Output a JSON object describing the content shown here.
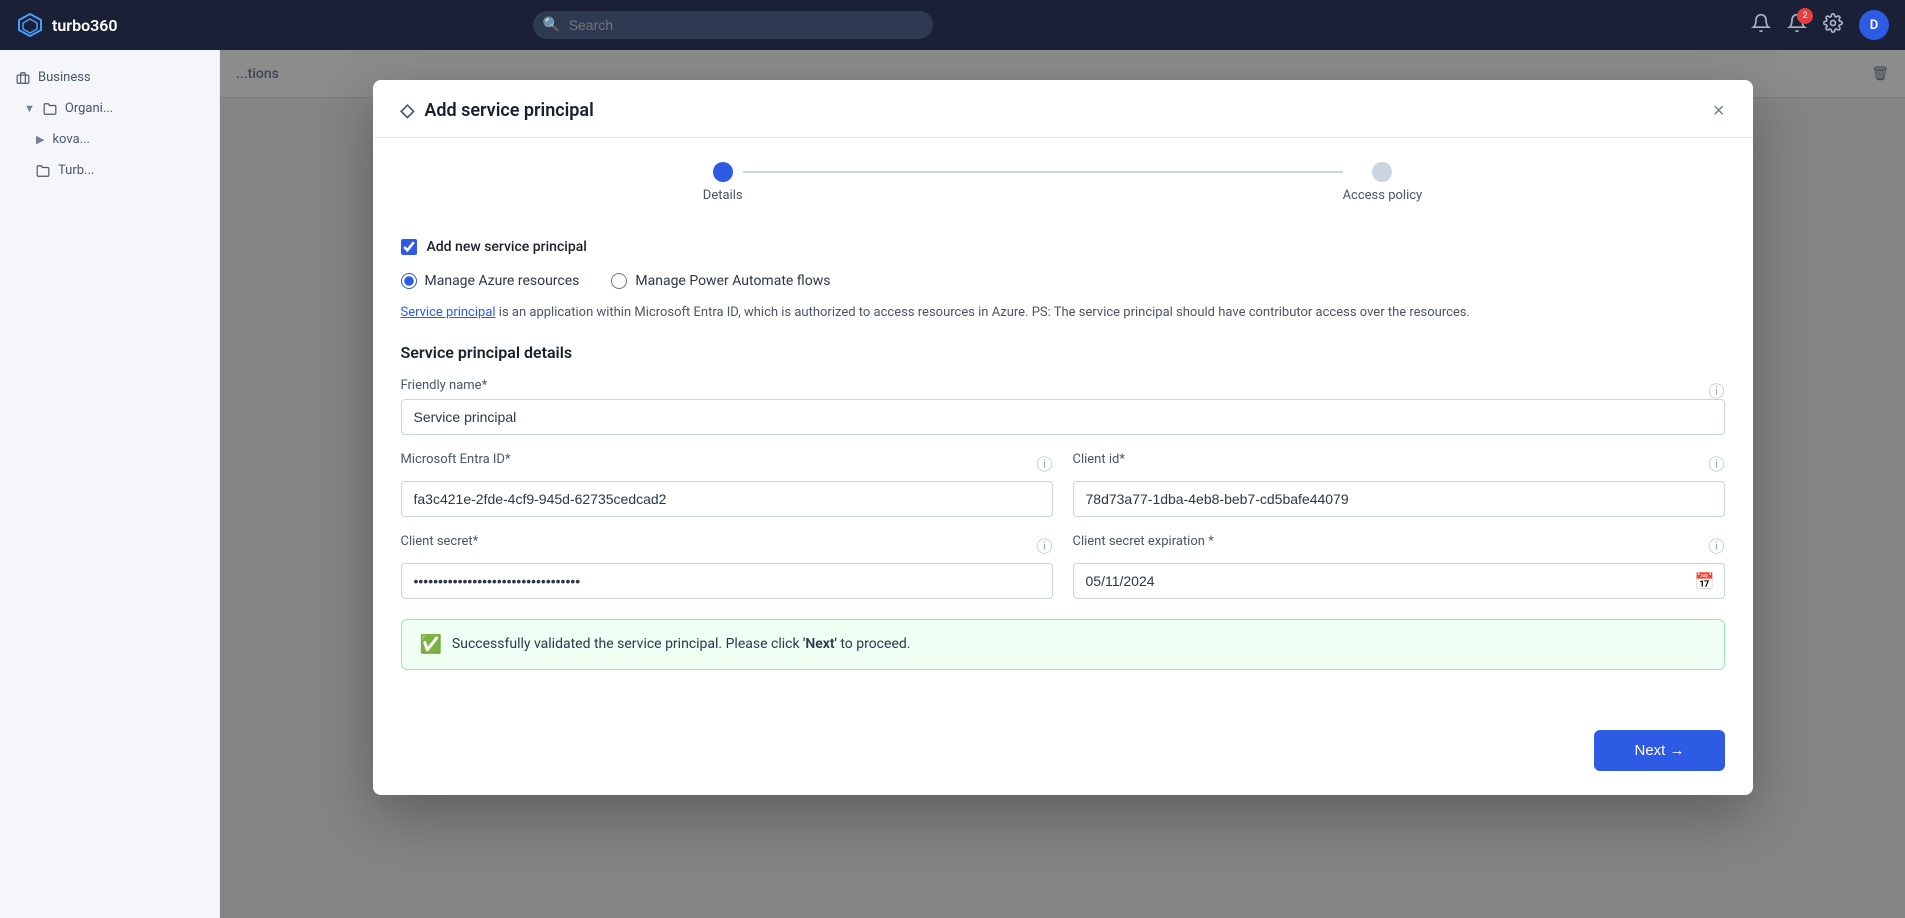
{
  "topnav": {
    "logo_text": "turbo360",
    "search_placeholder": "Search",
    "notification_badge": "2",
    "avatar_letter": "D"
  },
  "sidebar": {
    "section_label": "Business",
    "items": [
      {
        "label": "Organi..."
      },
      {
        "label": "kova..."
      },
      {
        "label": "Turb..."
      }
    ]
  },
  "modal": {
    "title": "Add service principal",
    "close_label": "×",
    "stepper": {
      "step1_label": "Details",
      "step2_label": "Access policy"
    },
    "checkbox": {
      "label": "Add new service principal",
      "checked": true
    },
    "radio": {
      "option1_label": "Manage Azure resources",
      "option2_label": "Manage Power Automate flows"
    },
    "description": "Service principal is an application within Microsoft Entra ID, which is authorized to access resources in Azure. PS: The service principal should have contributor access over the resources.",
    "description_link": "Service principal",
    "section_heading": "Service principal details",
    "fields": {
      "friendly_name_label": "Friendly name*",
      "friendly_name_value": "Service principal",
      "entra_id_label": "Microsoft Entra ID*",
      "entra_id_value": "fa3c421e-2fde-4cf9-945d-62735cedcad2",
      "client_id_label": "Client id*",
      "client_id_value": "78d73a77-1dba-4eb8-beb7-cd5bafe44079",
      "client_secret_label": "Client secret*",
      "client_secret_value": "••••••••••••••••••••••••••••••••••",
      "client_secret_exp_label": "Client secret expiration *",
      "client_secret_exp_value": "05/11/2024"
    },
    "success": {
      "text_before": "Successfully validated the service principal. Please click ",
      "text_bold": "'Next'",
      "text_after": " to proceed."
    },
    "next_button_label": "Next →"
  }
}
